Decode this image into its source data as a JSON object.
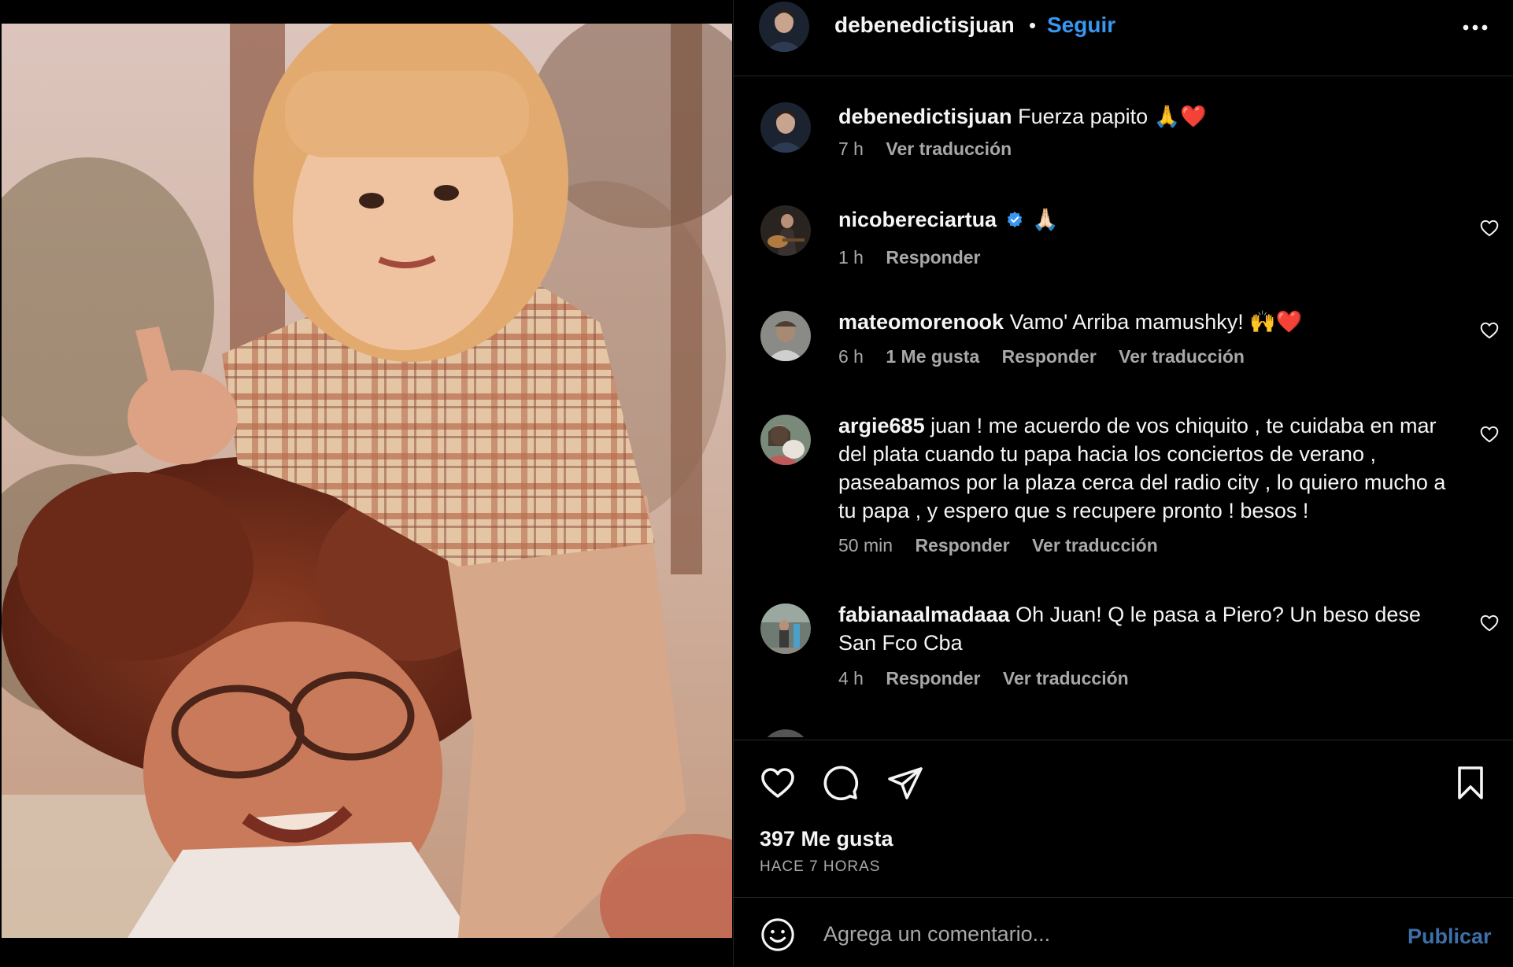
{
  "header": {
    "username": "debenedictisjuan",
    "separator": "•",
    "follow_label": "Seguir"
  },
  "comments": [
    {
      "username": "debenedictisjuan",
      "text": "Fuerza papito 🙏❤️",
      "time": "7 h",
      "likes": "",
      "reply": "",
      "translate": "Ver traducción",
      "verified": false
    },
    {
      "username": "nicobereciartua",
      "text": "🙏🏻",
      "time": "1 h",
      "likes": "",
      "reply": "Responder",
      "translate": "",
      "verified": true
    },
    {
      "username": "mateomorenook",
      "text": "Vamo' Arriba mamushky! 🙌❤️",
      "time": "6 h",
      "likes": "1 Me gusta",
      "reply": "Responder",
      "translate": "Ver traducción",
      "verified": false
    },
    {
      "username": "argie685",
      "text": "juan ! me acuerdo de vos chiquito , te cuidaba en mar del plata cuando tu papa hacia los conciertos de verano , paseabamos por la plaza cerca del radio city , lo quiero mucho a tu papa , y espero que s recupere pronto ! besos !",
      "time": "50 min",
      "likes": "",
      "reply": "Responder",
      "translate": "Ver traducción",
      "verified": false
    },
    {
      "username": "fabianaalmadaaa",
      "text": "Oh Juan! Q le pasa a Piero? Un beso dese San Fco Cba",
      "time": "4 h",
      "likes": "",
      "reply": "Responder",
      "translate": "Ver traducción",
      "verified": false
    }
  ],
  "actions": {
    "icons": [
      "heart-icon",
      "comment-icon",
      "share-icon",
      "bookmark-icon"
    ],
    "likes_label": "397 Me gusta",
    "time_label": "HACE 7 HORAS"
  },
  "compose": {
    "placeholder": "Agrega un comentario...",
    "publish_label": "Publicar"
  },
  "colors": {
    "background": "#000000",
    "text": "#f5f5f5",
    "muted": "#a8a8a8",
    "link": "#3897f0",
    "publish": "#3d6fa8"
  }
}
